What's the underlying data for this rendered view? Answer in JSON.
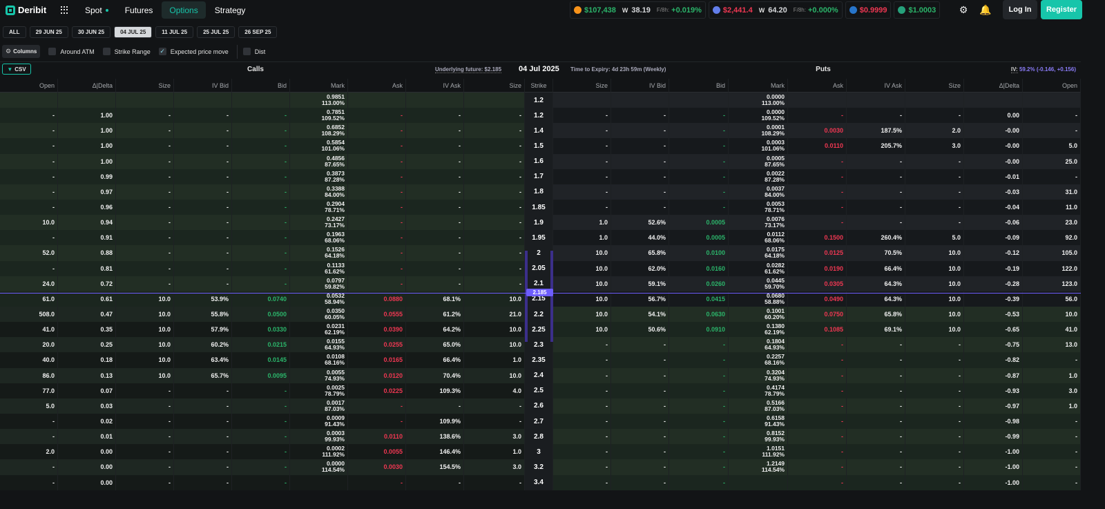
{
  "brand": {
    "name": "Deribit"
  },
  "nav": {
    "links": [
      {
        "label": "Spot",
        "active": false
      },
      {
        "label": "Futures",
        "active": false
      },
      {
        "label": "Options",
        "active": true
      },
      {
        "label": "Strategy",
        "active": false
      }
    ]
  },
  "tickers": {
    "btc": {
      "price": "$107,438",
      "vol": "38.19",
      "funding_label": "F/8h:",
      "funding": "+0.019%",
      "color": "#f7931a"
    },
    "eth": {
      "price": "$2,441.4",
      "vol": "64.20",
      "funding_label": "F/8h:",
      "funding": "+0.000%",
      "color": "#627eea"
    },
    "usdc": {
      "price": "$0.9999",
      "color": "#2775ca"
    },
    "usde": {
      "price": "$1.0003",
      "color": "#26a17b"
    }
  },
  "auth": {
    "login": "Log In",
    "register": "Register"
  },
  "expiries": [
    {
      "label": "ALL",
      "active": false
    },
    {
      "label": "29 JUN 25",
      "active": false
    },
    {
      "label": "30 JUN 25",
      "active": false
    },
    {
      "label": "04 JUL 25",
      "active": true
    },
    {
      "label": "11 JUL 25",
      "active": false
    },
    {
      "label": "25 JUL 25",
      "active": false
    },
    {
      "label": "26 SEP 25",
      "active": false
    }
  ],
  "filters": {
    "columns_label": "Columns",
    "options": [
      {
        "label": "Around ATM",
        "checked": false
      },
      {
        "label": "Strike Range",
        "checked": false
      },
      {
        "label": "Expected price move",
        "checked": true
      },
      {
        "label": "Dist",
        "checked": false
      }
    ]
  },
  "header": {
    "csv": "CSV",
    "calls": "Calls",
    "puts": "Puts",
    "underlying": "Underlying future: $2.185",
    "expiry_date": "04 Jul 2025",
    "time_to_expiry": "Time to Expiry: 4d 23h 59m (Weekly)",
    "iv_label": "IV:",
    "iv_value": "59.2% (-0.146, +0.156)",
    "atm_price": "2.185"
  },
  "columns": {
    "calls": [
      "Open",
      "Δ|Delta",
      "Size",
      "IV Bid",
      "Bid",
      "Mark",
      "Ask",
      "IV Ask",
      "Size"
    ],
    "strike": "Strike",
    "puts": [
      "Size",
      "IV Bid",
      "Bid",
      "Mark",
      "Ask",
      "IV Ask",
      "Size",
      "Δ|Delta",
      "Open"
    ]
  },
  "rows": [
    {
      "strike": "1.2",
      "call": {
        "open": "",
        "delta": "",
        "size_bid": "",
        "iv_bid": "",
        "bid": "",
        "mark": "0.9851",
        "mark_iv": "113.00%",
        "ask": "",
        "iv_ask": "",
        "size_ask": ""
      },
      "put": {
        "size_bid": "",
        "iv_bid": "",
        "bid": "",
        "mark": "0.0000",
        "mark_iv": "113.00%",
        "ask": "",
        "iv_ask": "",
        "size_ask": "",
        "delta": "",
        "open": ""
      }
    },
    {
      "strike": "1.2",
      "call": {
        "open": "-",
        "delta": "1.00",
        "size_bid": "-",
        "iv_bid": "-",
        "bid": "-",
        "mark": "0.7851",
        "mark_iv": "109.52%",
        "ask": "-",
        "iv_ask": "-",
        "size_ask": "-"
      },
      "put": {
        "size_bid": "-",
        "iv_bid": "-",
        "bid": "-",
        "mark": "0.0000",
        "mark_iv": "109.52%",
        "ask": "-",
        "iv_ask": "-",
        "size_ask": "-",
        "delta": "0.00",
        "open": "-"
      }
    },
    {
      "strike": "1.4",
      "call": {
        "open": "-",
        "delta": "1.00",
        "size_bid": "-",
        "iv_bid": "-",
        "bid": "-",
        "mark": "0.6852",
        "mark_iv": "108.29%",
        "ask": "-",
        "iv_ask": "-",
        "size_ask": "-"
      },
      "put": {
        "size_bid": "-",
        "iv_bid": "-",
        "bid": "-",
        "mark": "0.0001",
        "mark_iv": "108.29%",
        "ask": "0.0030",
        "iv_ask": "187.5%",
        "size_ask": "2.0",
        "delta": "-0.00",
        "open": "-"
      }
    },
    {
      "strike": "1.5",
      "call": {
        "open": "-",
        "delta": "1.00",
        "size_bid": "-",
        "iv_bid": "-",
        "bid": "-",
        "mark": "0.5854",
        "mark_iv": "101.06%",
        "ask": "-",
        "iv_ask": "-",
        "size_ask": "-"
      },
      "put": {
        "size_bid": "-",
        "iv_bid": "-",
        "bid": "-",
        "mark": "0.0003",
        "mark_iv": "101.06%",
        "ask": "0.0110",
        "iv_ask": "205.7%",
        "size_ask": "3.0",
        "delta": "-0.00",
        "open": "5.0"
      }
    },
    {
      "strike": "1.6",
      "call": {
        "open": "-",
        "delta": "1.00",
        "size_bid": "-",
        "iv_bid": "-",
        "bid": "-",
        "mark": "0.4856",
        "mark_iv": "87.65%",
        "ask": "-",
        "iv_ask": "-",
        "size_ask": "-"
      },
      "put": {
        "size_bid": "-",
        "iv_bid": "-",
        "bid": "-",
        "mark": "0.0005",
        "mark_iv": "87.65%",
        "ask": "-",
        "iv_ask": "-",
        "size_ask": "-",
        "delta": "-0.00",
        "open": "25.0"
      }
    },
    {
      "strike": "1.7",
      "call": {
        "open": "-",
        "delta": "0.99",
        "size_bid": "-",
        "iv_bid": "-",
        "bid": "-",
        "mark": "0.3873",
        "mark_iv": "87.28%",
        "ask": "-",
        "iv_ask": "-",
        "size_ask": "-"
      },
      "put": {
        "size_bid": "-",
        "iv_bid": "-",
        "bid": "-",
        "mark": "0.0022",
        "mark_iv": "87.28%",
        "ask": "-",
        "iv_ask": "-",
        "size_ask": "-",
        "delta": "-0.01",
        "open": "-"
      }
    },
    {
      "strike": "1.8",
      "call": {
        "open": "-",
        "delta": "0.97",
        "size_bid": "-",
        "iv_bid": "-",
        "bid": "-",
        "mark": "0.3388",
        "mark_iv": "84.00%",
        "ask": "-",
        "iv_ask": "-",
        "size_ask": "-"
      },
      "put": {
        "size_bid": "-",
        "iv_bid": "-",
        "bid": "-",
        "mark": "0.0037",
        "mark_iv": "84.00%",
        "ask": "-",
        "iv_ask": "-",
        "size_ask": "-",
        "delta": "-0.03",
        "open": "31.0"
      }
    },
    {
      "strike": "1.85",
      "call": {
        "open": "-",
        "delta": "0.96",
        "size_bid": "-",
        "iv_bid": "-",
        "bid": "-",
        "mark": "0.2904",
        "mark_iv": "78.71%",
        "ask": "-",
        "iv_ask": "-",
        "size_ask": "-"
      },
      "put": {
        "size_bid": "-",
        "iv_bid": "-",
        "bid": "-",
        "mark": "0.0053",
        "mark_iv": "78.71%",
        "ask": "-",
        "iv_ask": "-",
        "size_ask": "-",
        "delta": "-0.04",
        "open": "11.0"
      }
    },
    {
      "strike": "1.9",
      "call": {
        "open": "10.0",
        "delta": "0.94",
        "size_bid": "-",
        "iv_bid": "-",
        "bid": "-",
        "mark": "0.2427",
        "mark_iv": "73.17%",
        "ask": "-",
        "iv_ask": "-",
        "size_ask": "-"
      },
      "put": {
        "size_bid": "1.0",
        "iv_bid": "52.6%",
        "bid": "0.0005",
        "mark": "0.0076",
        "mark_iv": "73.17%",
        "ask": "-",
        "iv_ask": "-",
        "size_ask": "-",
        "delta": "-0.06",
        "open": "23.0"
      }
    },
    {
      "strike": "1.95",
      "call": {
        "open": "-",
        "delta": "0.91",
        "size_bid": "-",
        "iv_bid": "-",
        "bid": "-",
        "mark": "0.1963",
        "mark_iv": "68.06%",
        "ask": "-",
        "iv_ask": "-",
        "size_ask": "-"
      },
      "put": {
        "size_bid": "1.0",
        "iv_bid": "44.0%",
        "bid": "0.0005",
        "mark": "0.0112",
        "mark_iv": "68.06%",
        "ask": "0.1500",
        "iv_ask": "260.4%",
        "size_ask": "5.0",
        "delta": "-0.09",
        "open": "92.0"
      }
    },
    {
      "strike": "2",
      "call": {
        "open": "52.0",
        "delta": "0.88",
        "size_bid": "-",
        "iv_bid": "-",
        "bid": "-",
        "mark": "0.1526",
        "mark_iv": "64.18%",
        "ask": "-",
        "iv_ask": "-",
        "size_ask": "-"
      },
      "put": {
        "size_bid": "10.0",
        "iv_bid": "65.8%",
        "bid": "0.0100",
        "mark": "0.0175",
        "mark_iv": "64.18%",
        "ask": "0.0125",
        "iv_ask": "70.5%",
        "size_ask": "10.0",
        "delta": "-0.12",
        "open": "105.0"
      }
    },
    {
      "strike": "2.05",
      "call": {
        "open": "-",
        "delta": "0.81",
        "size_bid": "-",
        "iv_bid": "-",
        "bid": "-",
        "mark": "0.1133",
        "mark_iv": "61.62%",
        "ask": "-",
        "iv_ask": "-",
        "size_ask": "-"
      },
      "put": {
        "size_bid": "10.0",
        "iv_bid": "62.0%",
        "bid": "0.0160",
        "mark": "0.0282",
        "mark_iv": "61.62%",
        "ask": "0.0190",
        "iv_ask": "66.4%",
        "size_ask": "10.0",
        "delta": "-0.19",
        "open": "122.0"
      }
    },
    {
      "strike": "2.1",
      "call": {
        "open": "24.0",
        "delta": "0.72",
        "size_bid": "-",
        "iv_bid": "-",
        "bid": "-",
        "mark": "0.0797",
        "mark_iv": "59.82%",
        "ask": "-",
        "iv_ask": "-",
        "size_ask": "-"
      },
      "put": {
        "size_bid": "10.0",
        "iv_bid": "59.1%",
        "bid": "0.0260",
        "mark": "0.0445",
        "mark_iv": "59.70%",
        "ask": "0.0305",
        "iv_ask": "64.3%",
        "size_ask": "10.0",
        "delta": "-0.28",
        "open": "123.0"
      }
    },
    {
      "strike": "2.15",
      "call": {
        "open": "61.0",
        "delta": "0.61",
        "size_bid": "10.0",
        "iv_bid": "53.9%",
        "bid": "0.0740",
        "mark": "0.0532",
        "mark_iv": "58.94%",
        "ask": "0.0880",
        "iv_ask": "68.1%",
        "size_ask": "10.0"
      },
      "put": {
        "size_bid": "10.0",
        "iv_bid": "56.7%",
        "bid": "0.0415",
        "mark": "0.0680",
        "mark_iv": "58.88%",
        "ask": "0.0490",
        "iv_ask": "64.3%",
        "size_ask": "10.0",
        "delta": "-0.39",
        "open": "56.0"
      }
    },
    {
      "strike": "2.2",
      "call": {
        "open": "508.0",
        "delta": "0.47",
        "size_bid": "10.0",
        "iv_bid": "55.8%",
        "bid": "0.0500",
        "mark": "0.0350",
        "mark_iv": "60.05%",
        "ask": "0.0555",
        "iv_ask": "61.2%",
        "size_ask": "21.0"
      },
      "put": {
        "size_bid": "10.0",
        "iv_bid": "54.1%",
        "bid": "0.0630",
        "mark": "0.1001",
        "mark_iv": "60.20%",
        "ask": "0.0750",
        "iv_ask": "65.8%",
        "size_ask": "10.0",
        "delta": "-0.53",
        "open": "10.0"
      }
    },
    {
      "strike": "2.25",
      "call": {
        "open": "41.0",
        "delta": "0.35",
        "size_bid": "10.0",
        "iv_bid": "57.9%",
        "bid": "0.0330",
        "mark": "0.0231",
        "mark_iv": "62.19%",
        "ask": "0.0390",
        "iv_ask": "64.2%",
        "size_ask": "10.0"
      },
      "put": {
        "size_bid": "10.0",
        "iv_bid": "50.6%",
        "bid": "0.0910",
        "mark": "0.1380",
        "mark_iv": "62.19%",
        "ask": "0.1085",
        "iv_ask": "69.1%",
        "size_ask": "10.0",
        "delta": "-0.65",
        "open": "41.0"
      }
    },
    {
      "strike": "2.3",
      "call": {
        "open": "20.0",
        "delta": "0.25",
        "size_bid": "10.0",
        "iv_bid": "60.2%",
        "bid": "0.0215",
        "mark": "0.0155",
        "mark_iv": "64.93%",
        "ask": "0.0255",
        "iv_ask": "65.0%",
        "size_ask": "10.0"
      },
      "put": {
        "size_bid": "-",
        "iv_bid": "-",
        "bid": "-",
        "mark": "0.1804",
        "mark_iv": "64.93%",
        "ask": "-",
        "iv_ask": "-",
        "size_ask": "-",
        "delta": "-0.75",
        "open": "13.0"
      }
    },
    {
      "strike": "2.35",
      "call": {
        "open": "40.0",
        "delta": "0.18",
        "size_bid": "10.0",
        "iv_bid": "63.4%",
        "bid": "0.0145",
        "mark": "0.0108",
        "mark_iv": "68.16%",
        "ask": "0.0165",
        "iv_ask": "66.4%",
        "size_ask": "1.0"
      },
      "put": {
        "size_bid": "-",
        "iv_bid": "-",
        "bid": "-",
        "mark": "0.2257",
        "mark_iv": "68.16%",
        "ask": "-",
        "iv_ask": "-",
        "size_ask": "-",
        "delta": "-0.82",
        "open": "-"
      }
    },
    {
      "strike": "2.4",
      "call": {
        "open": "86.0",
        "delta": "0.13",
        "size_bid": "10.0",
        "iv_bid": "65.7%",
        "bid": "0.0095",
        "mark": "0.0055",
        "mark_iv": "74.93%",
        "ask": "0.0120",
        "iv_ask": "70.4%",
        "size_ask": "10.0"
      },
      "put": {
        "size_bid": "-",
        "iv_bid": "-",
        "bid": "-",
        "mark": "0.3204",
        "mark_iv": "74.93%",
        "ask": "-",
        "iv_ask": "-",
        "size_ask": "-",
        "delta": "-0.87",
        "open": "1.0"
      }
    },
    {
      "strike": "2.5",
      "call": {
        "open": "77.0",
        "delta": "0.07",
        "size_bid": "-",
        "iv_bid": "-",
        "bid": "-",
        "mark": "0.0025",
        "mark_iv": "78.79%",
        "ask": "0.0225",
        "iv_ask": "109.3%",
        "size_ask": "4.0"
      },
      "put": {
        "size_bid": "-",
        "iv_bid": "-",
        "bid": "-",
        "mark": "0.4174",
        "mark_iv": "78.79%",
        "ask": "-",
        "iv_ask": "-",
        "size_ask": "-",
        "delta": "-0.93",
        "open": "3.0"
      }
    },
    {
      "strike": "2.6",
      "call": {
        "open": "5.0",
        "delta": "0.03",
        "size_bid": "-",
        "iv_bid": "-",
        "bid": "-",
        "mark": "0.0017",
        "mark_iv": "87.03%",
        "ask": "-",
        "iv_ask": "-",
        "size_ask": "-"
      },
      "put": {
        "size_bid": "-",
        "iv_bid": "-",
        "bid": "-",
        "mark": "0.5166",
        "mark_iv": "87.03%",
        "ask": "-",
        "iv_ask": "-",
        "size_ask": "-",
        "delta": "-0.97",
        "open": "1.0"
      }
    },
    {
      "strike": "2.7",
      "call": {
        "open": "-",
        "delta": "0.02",
        "size_bid": "-",
        "iv_bid": "-",
        "bid": "-",
        "mark": "0.0009",
        "mark_iv": "91.43%",
        "ask": "-",
        "iv_ask": "109.9%",
        "size_ask": "-"
      },
      "put": {
        "size_bid": "-",
        "iv_bid": "-",
        "bid": "-",
        "mark": "0.6158",
        "mark_iv": "91.43%",
        "ask": "-",
        "iv_ask": "-",
        "size_ask": "-",
        "delta": "-0.98",
        "open": "-"
      }
    },
    {
      "strike": "2.8",
      "call": {
        "open": "-",
        "delta": "0.01",
        "size_bid": "-",
        "iv_bid": "-",
        "bid": "-",
        "mark": "0.0003",
        "mark_iv": "99.93%",
        "ask": "0.0110",
        "iv_ask": "138.6%",
        "size_ask": "3.0"
      },
      "put": {
        "size_bid": "-",
        "iv_bid": "-",
        "bid": "-",
        "mark": "0.8152",
        "mark_iv": "99.93%",
        "ask": "-",
        "iv_ask": "-",
        "size_ask": "-",
        "delta": "-0.99",
        "open": "-"
      }
    },
    {
      "strike": "3",
      "call": {
        "open": "2.0",
        "delta": "0.00",
        "size_bid": "-",
        "iv_bid": "-",
        "bid": "-",
        "mark": "0.0002",
        "mark_iv": "111.92%",
        "ask": "0.0055",
        "iv_ask": "146.4%",
        "size_ask": "1.0"
      },
      "put": {
        "size_bid": "-",
        "iv_bid": "-",
        "bid": "-",
        "mark": "1.0151",
        "mark_iv": "111.92%",
        "ask": "-",
        "iv_ask": "-",
        "size_ask": "-",
        "delta": "-1.00",
        "open": "-"
      }
    },
    {
      "strike": "3.2",
      "call": {
        "open": "-",
        "delta": "0.00",
        "size_bid": "-",
        "iv_bid": "-",
        "bid": "-",
        "mark": "0.0000",
        "mark_iv": "114.54%",
        "ask": "0.0030",
        "iv_ask": "154.5%",
        "size_ask": "3.0"
      },
      "put": {
        "size_bid": "-",
        "iv_bid": "-",
        "bid": "-",
        "mark": "1.2149",
        "mark_iv": "114.54%",
        "ask": "-",
        "iv_ask": "-",
        "size_ask": "-",
        "delta": "-1.00",
        "open": "-"
      }
    },
    {
      "strike": "3.4",
      "call": {
        "open": "-",
        "delta": "0.00",
        "size_bid": "-",
        "iv_bid": "-",
        "bid": "-",
        "mark": "",
        "mark_iv": "",
        "ask": "-",
        "iv_ask": "-",
        "size_ask": "-"
      },
      "put": {
        "size_bid": "-",
        "iv_bid": "-",
        "bid": "-",
        "mark": "",
        "mark_iv": "",
        "ask": "-",
        "iv_ask": "-",
        "size_ask": "-",
        "delta": "-1.00",
        "open": "-"
      }
    }
  ]
}
